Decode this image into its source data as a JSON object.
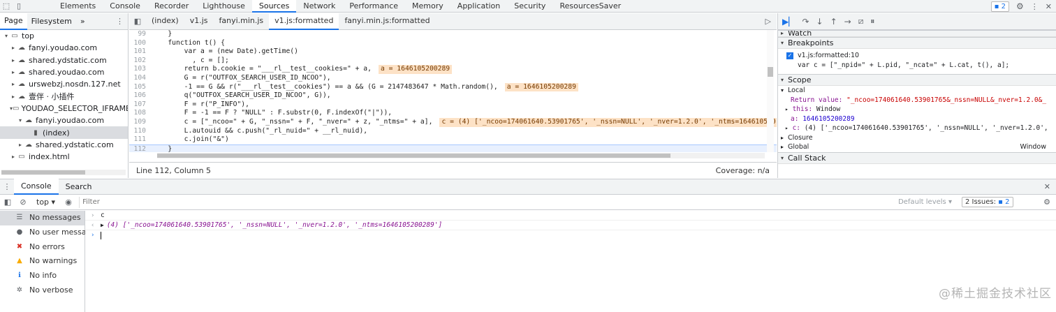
{
  "devtools": {
    "tabs": [
      "Elements",
      "Console",
      "Recorder",
      "Lighthouse",
      "Sources",
      "Network",
      "Performance",
      "Memory",
      "Application",
      "Security",
      "ResourcesSaver"
    ],
    "active_tab": "Sources",
    "issues_badge": "2"
  },
  "navigator": {
    "tabs": [
      "Page",
      "Filesystem"
    ],
    "more": "»",
    "tree": [
      {
        "label": "top",
        "indent": 0,
        "twisty": "▾",
        "icon": "frame-icon"
      },
      {
        "label": "fanyi.youdao.com",
        "indent": 1,
        "twisty": "▸",
        "icon": "cloud-icon"
      },
      {
        "label": "shared.ydstatic.com",
        "indent": 1,
        "twisty": "▸",
        "icon": "cloud-icon"
      },
      {
        "label": "shared.youdao.com",
        "indent": 1,
        "twisty": "▸",
        "icon": "cloud-icon"
      },
      {
        "label": "urswebzj.nosdn.127.net",
        "indent": 1,
        "twisty": "▸",
        "icon": "cloud-icon"
      },
      {
        "label": "壹伴 · 小插件",
        "indent": 1,
        "twisty": "▸",
        "icon": "cloud-icon"
      },
      {
        "label": "YOUDAO_SELECTOR_IFRAME (f",
        "indent": 1,
        "twisty": "▾",
        "icon": "frame-icon"
      },
      {
        "label": "fanyi.youdao.com",
        "indent": 2,
        "twisty": "▾",
        "icon": "cloud-icon"
      },
      {
        "label": "(index)",
        "indent": 3,
        "twisty": "",
        "icon": "file-icon"
      },
      {
        "label": "shared.ydstatic.com",
        "indent": 2,
        "twisty": "▸",
        "icon": "cloud-icon"
      },
      {
        "label": "index.html",
        "indent": 1,
        "twisty": "▸",
        "icon": "frame-icon"
      }
    ]
  },
  "editor": {
    "tabs": [
      "(index)",
      "v1.js",
      "fanyi.min.js",
      "v1.js:formatted",
      "fanyi.min.js:formatted"
    ],
    "active_tab": "v1.js:formatted",
    "lines": [
      {
        "n": "99",
        "code": "    }",
        "hint": ""
      },
      {
        "n": "100",
        "code": "    function t() {",
        "hint": ""
      },
      {
        "n": "101",
        "code": "        var a = (new Date).getTime()",
        "hint": ""
      },
      {
        "n": "102",
        "code": "          , c = [];",
        "hint": ""
      },
      {
        "n": "103",
        "code": "        return b.cookie = \"___rl__test__cookies=\" + a,",
        "hint": "a = 1646105200289"
      },
      {
        "n": "104",
        "code": "        G = r(\"OUTFOX_SEARCH_USER_ID_NCOO\"),",
        "hint": ""
      },
      {
        "n": "105",
        "code": "        -1 == G && r(\"___rl__test__cookies\") == a && (G = 2147483647 * Math.random(),",
        "hint": "a = 1646105200289"
      },
      {
        "n": "106",
        "code": "        q(\"OUTFOX_SEARCH_USER_ID_NCOO\", G)),",
        "hint": ""
      },
      {
        "n": "107",
        "code": "        F = r(\"P_INFO\"),",
        "hint": ""
      },
      {
        "n": "108",
        "code": "        F = -1 == F ? \"NULL\" : F.substr(0, F.indexOf(\"|\")),",
        "hint": ""
      },
      {
        "n": "109",
        "code": "        c = [\"_ncoo=\" + G, \"_nssn=\" + F, \"_nver=\" + z, \"_ntms=\" + a],",
        "hint": "c = (4) ['_ncoo=174061640.53901765', '_nssn=NULL', '_nver=1.2.0', '_ntms=164610520"
      },
      {
        "n": "110",
        "code": "        L.autouid && c.push(\"_rl_nuid=\" + __rl_nuid),",
        "hint": ""
      },
      {
        "n": "111",
        "code": "        c.join(\"&\")",
        "hint": ""
      },
      {
        "n": "112",
        "code": "    }",
        "hint": ""
      }
    ],
    "status_left": "Line 112, Column 5",
    "status_right": "Coverage: n/a"
  },
  "debugger": {
    "watch": "Watch",
    "breakpoints": "Breakpoints",
    "bp_file": "v1.js:formatted:10",
    "bp_code": "var c = [\"_npid=\" + L.pid, \"_ncat=\" + L.cat, t(), a];",
    "scope": "Scope",
    "local": "Local",
    "return_key": "Return value:",
    "return_val": "\"_ncoo=174061640.53901765&_nssn=NULL&_nver=1.2.0&_",
    "this_key": "this:",
    "this_val": "Window",
    "a_key": "a:",
    "a_val": "1646105200289",
    "c_key": "c:",
    "c_val": "(4) ['_ncoo=174061640.53901765', '_nssn=NULL', '_nver=1.2.0',",
    "closure": "Closure",
    "global": "Global",
    "global_val": "Window",
    "callstack": "Call Stack"
  },
  "console": {
    "tabs": [
      "Console",
      "Search"
    ],
    "context": "top",
    "filter_placeholder": "Filter",
    "levels": "Default levels",
    "issues": "2 Issues:",
    "issues_count": "2",
    "sidebar": [
      {
        "label": "No messages",
        "icon": "list-icon",
        "color": "#5f6368"
      },
      {
        "label": "No user messa...",
        "icon": "user-icon",
        "color": "#5f6368"
      },
      {
        "label": "No errors",
        "icon": "error-icon",
        "color": "#d93025"
      },
      {
        "label": "No warnings",
        "icon": "warning-icon",
        "color": "#f9ab00"
      },
      {
        "label": "No info",
        "icon": "info-icon",
        "color": "#1a73e8"
      },
      {
        "label": "No verbose",
        "icon": "verbose-icon",
        "color": "#5f6368"
      }
    ],
    "input_echo": "c",
    "result": "(4) ['_ncoo=174061640.53901765', '_nssn=NULL', '_nver=1.2.0', '_ntms=1646105200289']"
  },
  "watermark": "@稀土掘金技术社区"
}
